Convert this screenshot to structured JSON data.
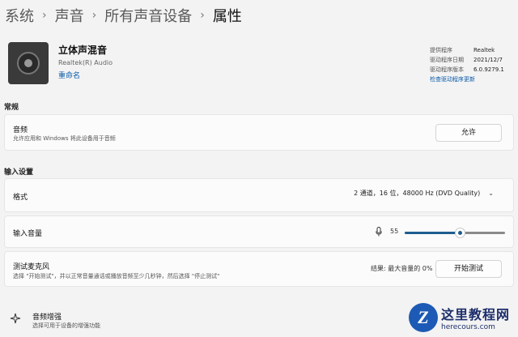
{
  "breadcrumb": {
    "items": [
      "系统",
      "声音",
      "所有声音设备"
    ],
    "current": "属性",
    "separator": "›"
  },
  "device": {
    "name": "立体声混音",
    "vendor": "Realtek(R) Audio",
    "rename_link": "重命名"
  },
  "driver": {
    "provider_label": "提供程序",
    "provider_value": "Realtek",
    "date_label": "驱动程序日期",
    "date_value": "2021/12/7",
    "version_label": "驱动程序版本",
    "version_value": "6.0.9279.1",
    "update_link": "检查驱动程序更新"
  },
  "general": {
    "header": "常规",
    "audio_title": "音频",
    "audio_desc": "允许应用和 Windows 将此设备用于音频",
    "allow_button": "允许"
  },
  "input_settings": {
    "header": "输入设置",
    "format_title": "格式",
    "format_value": "2 通道，16 位，48000 Hz (DVD Quality)",
    "volume_title": "输入音量",
    "volume_value": "55",
    "volume_level": 55,
    "test_title": "测试麦克风",
    "test_desc": "选择 \"开始测试\"，并以正常音量通话或播放音频至少几秒钟，然后选择 \"停止测试\"",
    "test_result": "结果: 最大音量的 0%",
    "start_test_button": "开始测试"
  },
  "enhancement": {
    "title": "音频增强",
    "desc": "选择可用于设备的增强功能"
  },
  "watermark": {
    "title": "这里教程网",
    "url": "herecours.com",
    "logo_letter": "Z"
  },
  "colors": {
    "accent": "#1f5c8f",
    "link": "#0b5aa8",
    "background": "#f3f3f3",
    "card": "#fbfbfb"
  }
}
